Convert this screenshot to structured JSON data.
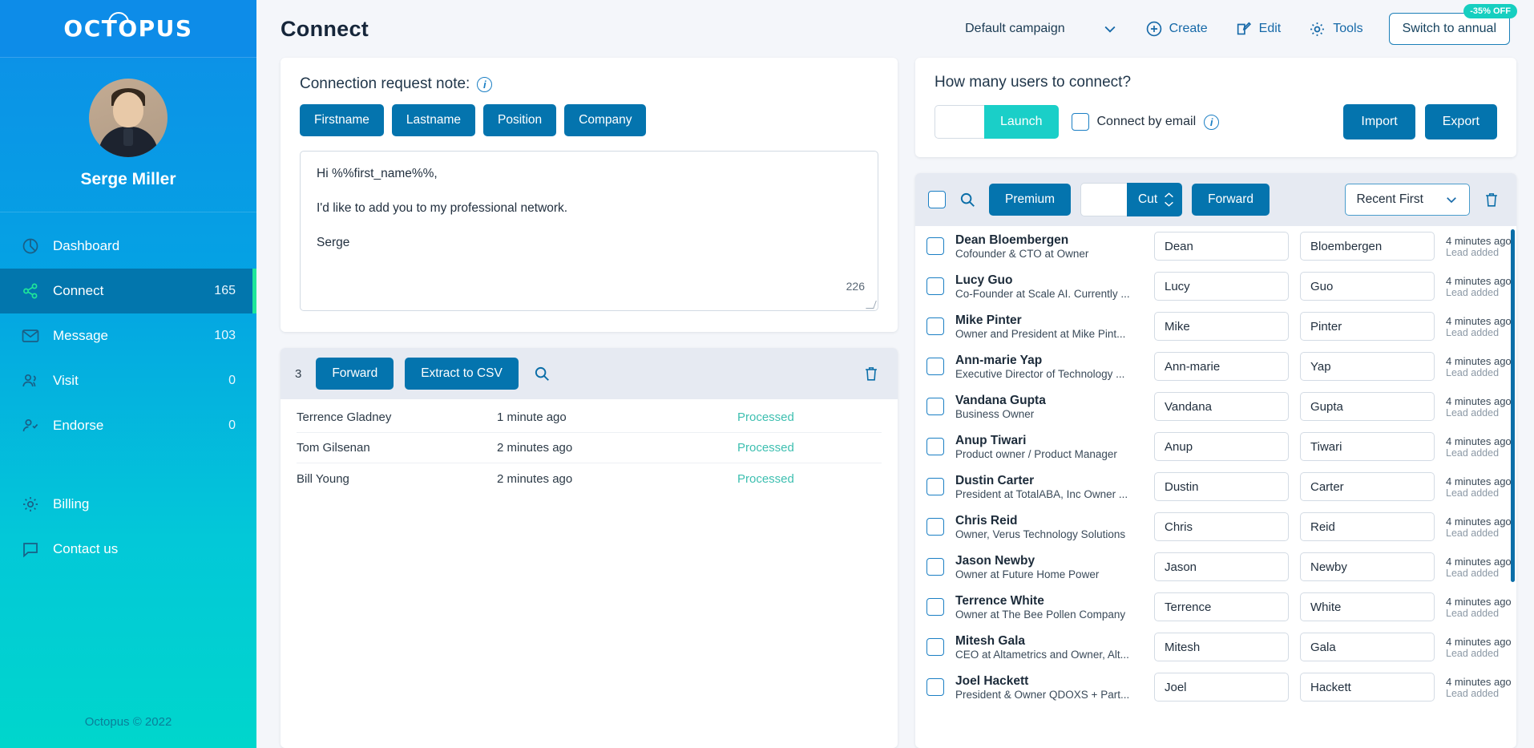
{
  "brand": {
    "logo_text": "OCTOPUS",
    "accent": "#0474ae",
    "teal": "#1acfc8",
    "green": "#1ee69a"
  },
  "sidebar": {
    "profile_name": "Serge Miller",
    "items": [
      {
        "label": "Dashboard",
        "icon": "dashboard-icon",
        "count": ""
      },
      {
        "label": "Connect",
        "icon": "share-icon",
        "count": "165"
      },
      {
        "label": "Message",
        "icon": "envelope-icon",
        "count": "103"
      },
      {
        "label": "Visit",
        "icon": "users-icon",
        "count": "0"
      },
      {
        "label": "Endorse",
        "icon": "user-check-icon",
        "count": "0"
      }
    ],
    "lower_items": [
      {
        "label": "Billing",
        "icon": "gear-icon"
      },
      {
        "label": "Contact us",
        "icon": "chat-icon"
      }
    ],
    "footer": "Octopus © 2022"
  },
  "topbar": {
    "page_title": "Connect",
    "campaign": "Default campaign",
    "create_label": "Create",
    "edit_label": "Edit",
    "tools_label": "Tools",
    "switch_label": "Switch to annual",
    "off_badge": "-35% OFF"
  },
  "note": {
    "heading": "Connection request note:",
    "tokens": [
      "Firstname",
      "Lastname",
      "Position",
      "Company"
    ],
    "lines": [
      "Hi %%first_name%%,",
      "I'd like to add you to my professional network.",
      "Serge"
    ],
    "char_count": "226"
  },
  "processed": {
    "count": "3",
    "forward_label": "Forward",
    "extract_label": "Extract to CSV",
    "rows": [
      {
        "name": "Terrence Gladney",
        "time": "1 minute ago",
        "status": "Processed"
      },
      {
        "name": "Tom Gilsenan",
        "time": "2 minutes ago",
        "status": "Processed"
      },
      {
        "name": "Bill Young",
        "time": "2 minutes ago",
        "status": "Processed"
      }
    ]
  },
  "connect": {
    "question": "How many users to connect?",
    "amount_value": "",
    "launch_label": "Launch",
    "connect_by_email_label": "Connect by email",
    "import_label": "Import",
    "export_label": "Export"
  },
  "list_toolbar": {
    "premium_label": "Premium",
    "cut_value": "",
    "cut_label": "Cut",
    "forward_label": "Forward",
    "sort_value": "Recent First"
  },
  "leads": [
    {
      "name": "Dean Bloembergen",
      "title": "Cofounder & CTO at Owner",
      "first": "Dean",
      "last": "Bloembergen",
      "ago": "4 minutes ago",
      "event": "Lead added"
    },
    {
      "name": "Lucy Guo",
      "title": "Co-Founder at Scale AI. Currently ...",
      "first": "Lucy",
      "last": "Guo",
      "ago": "4 minutes ago",
      "event": "Lead added"
    },
    {
      "name": "Mike Pinter",
      "title": "Owner and President at Mike Pint...",
      "first": "Mike",
      "last": "Pinter",
      "ago": "4 minutes ago",
      "event": "Lead added"
    },
    {
      "name": "Ann-marie Yap",
      "title": "Executive Director of Technology ...",
      "first": "Ann-marie",
      "last": "Yap",
      "ago": "4 minutes ago",
      "event": "Lead added"
    },
    {
      "name": "Vandana Gupta",
      "title": "Business Owner",
      "first": "Vandana",
      "last": "Gupta",
      "ago": "4 minutes ago",
      "event": "Lead added"
    },
    {
      "name": "Anup Tiwari",
      "title": "Product owner / Product Manager",
      "first": "Anup",
      "last": "Tiwari",
      "ago": "4 minutes ago",
      "event": "Lead added"
    },
    {
      "name": "Dustin Carter",
      "title": "President at TotalABA, Inc Owner ...",
      "first": "Dustin",
      "last": "Carter",
      "ago": "4 minutes ago",
      "event": "Lead added"
    },
    {
      "name": "Chris Reid",
      "title": "Owner, Verus Technology Solutions",
      "first": "Chris",
      "last": "Reid",
      "ago": "4 minutes ago",
      "event": "Lead added"
    },
    {
      "name": "Jason Newby",
      "title": "Owner at Future Home Power",
      "first": "Jason",
      "last": "Newby",
      "ago": "4 minutes ago",
      "event": "Lead added"
    },
    {
      "name": "Terrence White",
      "title": "Owner at The Bee Pollen Company",
      "first": "Terrence",
      "last": "White",
      "ago": "4 minutes ago",
      "event": "Lead added"
    },
    {
      "name": "Mitesh Gala",
      "title": "CEO at Altametrics and Owner, Alt...",
      "first": "Mitesh",
      "last": "Gala",
      "ago": "4 minutes ago",
      "event": "Lead added"
    },
    {
      "name": "Joel Hackett",
      "title": "President & Owner QDOXS + Part...",
      "first": "Joel",
      "last": "Hackett",
      "ago": "4 minutes ago",
      "event": "Lead added"
    }
  ]
}
